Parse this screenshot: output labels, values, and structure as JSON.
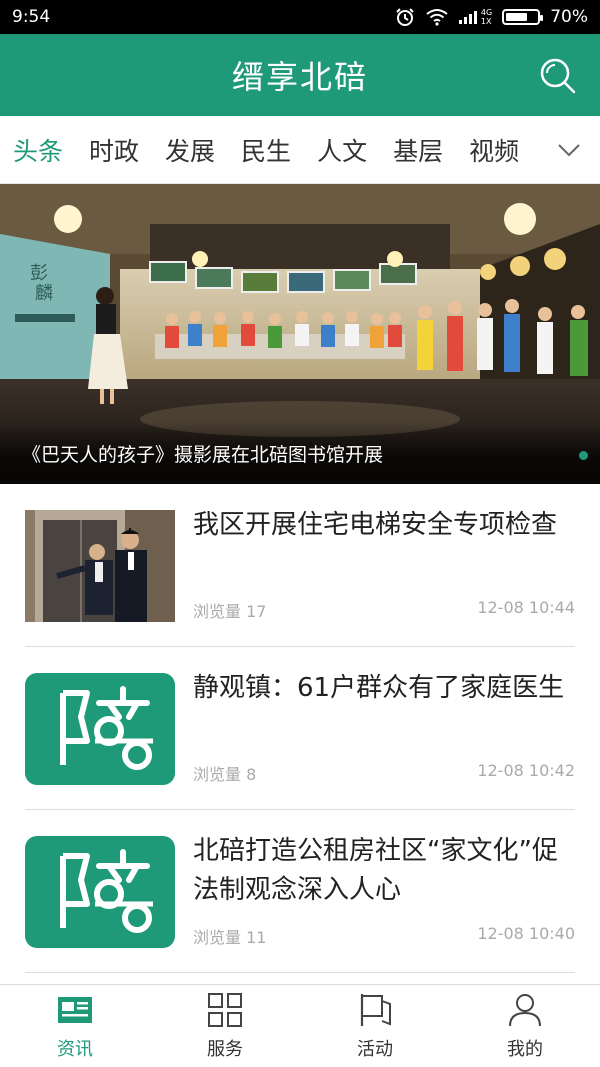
{
  "status_bar": {
    "time": "9:54",
    "network_type": "4G",
    "network_sub": "1X",
    "battery": "70%",
    "battery_level": 0.7,
    "icons": [
      "alarm-icon",
      "wifi-icon",
      "signal-icon",
      "battery-icon"
    ]
  },
  "app_bar": {
    "title": "缙享北碚",
    "search_icon": "search-icon"
  },
  "tabs": [
    {
      "label": "头条",
      "active": true
    },
    {
      "label": "时政",
      "active": false
    },
    {
      "label": "发展",
      "active": false
    },
    {
      "label": "民生",
      "active": false
    },
    {
      "label": "人文",
      "active": false
    },
    {
      "label": "基层",
      "active": false
    },
    {
      "label": "视频",
      "active": false
    }
  ],
  "tabs_more_icon": "chevron-down-icon",
  "banner": {
    "caption": "《巴天人的孩子》摄影展在北碚图书馆开展",
    "page_indicator_icon": "carousel-dot-icon"
  },
  "news": [
    {
      "title": "我区开展住宅电梯安全专项检查",
      "views": "浏览量 17",
      "time": "12-08 10:44",
      "thumb": "photo"
    },
    {
      "title": "静观镇：61户群众有了家庭医生",
      "views": "浏览量 8",
      "time": "12-08 10:42",
      "thumb": "logo"
    },
    {
      "title": "北碚打造公租房社区“家文化”促法制观念深入人心",
      "views": "浏览量 11",
      "time": "12-08 10:40",
      "thumb": "logo"
    }
  ],
  "bottom_nav": [
    {
      "label": "资讯",
      "icon": "news-icon",
      "active": true
    },
    {
      "label": "服务",
      "icon": "grid-icon",
      "active": false
    },
    {
      "label": "活动",
      "icon": "flag-icon",
      "active": false
    },
    {
      "label": "我的",
      "icon": "user-icon",
      "active": false
    }
  ],
  "colors": {
    "brand": "#1f9a78",
    "text": "#222222",
    "muted": "#aaaaaa"
  }
}
